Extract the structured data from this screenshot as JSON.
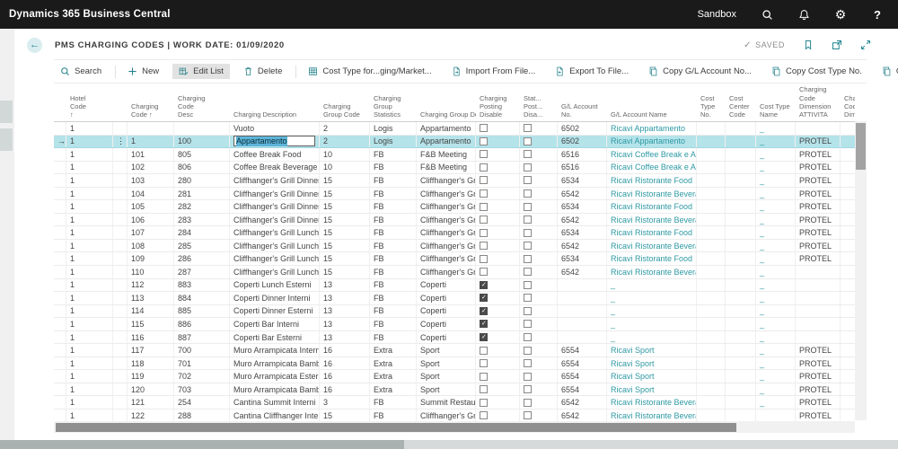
{
  "topbar": {
    "brand": "Dynamics 365 Business Central",
    "environment": "Sandbox",
    "help_label": "?"
  },
  "page": {
    "back_glyph": "←",
    "title": "PMS CHARGING CODES | WORK DATE: 01/09/2020",
    "saved_check": "✓",
    "saved_label": "SAVED"
  },
  "toolbar": {
    "items": [
      {
        "id": "search",
        "label": "Search",
        "icon": "magnifier-icon"
      },
      {
        "id": "new",
        "label": "New",
        "icon": "plus-icon"
      },
      {
        "id": "edit-list",
        "label": "Edit List",
        "icon": "edit-list-icon",
        "active": true
      },
      {
        "id": "delete",
        "label": "Delete",
        "icon": "trash-icon"
      },
      {
        "id": "cost-type-marketing",
        "label": "Cost Type for...ging/Market...",
        "icon": "table-icon"
      },
      {
        "id": "import-from-file",
        "label": "Import From File...",
        "icon": "import-file-icon"
      },
      {
        "id": "export-to-file",
        "label": "Export To File...",
        "icon": "export-file-icon"
      },
      {
        "id": "copy-gl-account",
        "label": "Copy G/L Account No...",
        "icon": "copy-icon"
      },
      {
        "id": "copy-cost-type",
        "label": "Copy Cost Type No.",
        "icon": "copy-icon"
      },
      {
        "id": "copy-cost-center",
        "label": "Copy Cost Center Code",
        "icon": "copy-icon"
      }
    ],
    "overflow_label": "⋯"
  },
  "table": {
    "headers": [
      "",
      "Hotel\nCode\n↑",
      "",
      "Charging\nCode ↑",
      "Charging\nCode\nDesc",
      "Charging Description",
      "Charging\nGroup Code",
      "Charging\nGroup\nStatistics",
      "Charging Group Desc",
      "Charging\nPosting\nDisable",
      "Stat...\nPost...\nDisa...",
      "G/L Account\nNo.",
      "G/L Account Name",
      "Cost\nType\nNo.",
      "Cost\nCenter\nCode",
      "Cost Type\nName",
      "Charging\nCode\nDimension\nATTIVITA",
      "Cha\nCod\nDim"
    ],
    "selected_row_glyph": "→",
    "row_menu_glyph": "⋮",
    "rows": [
      [
        "1",
        "",
        "",
        "Vuoto",
        "2",
        "Logis",
        "Appartamento",
        0,
        0,
        "6502",
        "Ricavi Appartamento",
        "_",
        "",
        ""
      ],
      [
        "1",
        "1",
        "100",
        "Appartamento",
        "2",
        "Logis",
        "Appartamento",
        0,
        0,
        "6502",
        "Ricavi Appartamento",
        "_",
        "PROTEL",
        "sel"
      ],
      [
        "1",
        "101",
        "805",
        "Coffee Break Food",
        "10",
        "FB",
        "F&B Meeting",
        0,
        0,
        "6516",
        "Ricavi Coffee Break e Aperitivi",
        "_",
        "PROTEL",
        ""
      ],
      [
        "1",
        "102",
        "806",
        "Coffee Break Beverage",
        "10",
        "FB",
        "F&B Meeting",
        0,
        0,
        "6516",
        "Ricavi Coffee Break e Aperitivi",
        "_",
        "PROTEL",
        ""
      ],
      [
        "1",
        "103",
        "280",
        "Cliffhanger's Grill Dinner F...",
        "15",
        "FB",
        "Cliffhanger's Grill",
        0,
        0,
        "6534",
        "Ricavi Ristorante Food",
        "_",
        "PROTEL",
        ""
      ],
      [
        "1",
        "104",
        "281",
        "Cliffhanger's Grill Dinner B...",
        "15",
        "FB",
        "Cliffhanger's Grill",
        0,
        0,
        "6542",
        "Ricavi Ristorante Beverage",
        "_",
        "PROTEL",
        ""
      ],
      [
        "1",
        "105",
        "282",
        "Cliffhanger's Grill Dinner F...",
        "15",
        "FB",
        "Cliffhanger's Grill",
        0,
        0,
        "6534",
        "Ricavi Ristorante Food",
        "_",
        "PROTEL",
        ""
      ],
      [
        "1",
        "106",
        "283",
        "Cliffhanger's Grill Dinner B...",
        "15",
        "FB",
        "Cliffhanger's Grill",
        0,
        0,
        "6542",
        "Ricavi Ristorante Beverage",
        "_",
        "PROTEL",
        ""
      ],
      [
        "1",
        "107",
        "284",
        "Cliffhanger's Grill Lunch F...",
        "15",
        "FB",
        "Cliffhanger's Grill",
        0,
        0,
        "6534",
        "Ricavi Ristorante Food",
        "_",
        "PROTEL",
        ""
      ],
      [
        "1",
        "108",
        "285",
        "Cliffhanger's Grill Lunch B...",
        "15",
        "FB",
        "Cliffhanger's Grill",
        0,
        0,
        "6542",
        "Ricavi Ristorante Beverage",
        "_",
        "PROTEL",
        ""
      ],
      [
        "1",
        "109",
        "286",
        "Cliffhanger's Grill Lunch F...",
        "15",
        "FB",
        "Cliffhanger's Grill",
        0,
        0,
        "6534",
        "Ricavi Ristorante Food",
        "_",
        "PROTEL",
        ""
      ],
      [
        "1",
        "110",
        "287",
        "Cliffhanger's Grill Lunch B...",
        "15",
        "FB",
        "Cliffhanger's Grill",
        0,
        0,
        "6542",
        "Ricavi Ristorante Beverage",
        "_",
        "",
        ""
      ],
      [
        "1",
        "112",
        "883",
        "Coperti Lunch Esterni",
        "13",
        "FB",
        "Coperti",
        1,
        0,
        "",
        "_",
        "_",
        "",
        ""
      ],
      [
        "1",
        "113",
        "884",
        "Coperti Dinner Interni",
        "13",
        "FB",
        "Coperti",
        1,
        0,
        "",
        "_",
        "_",
        "",
        ""
      ],
      [
        "1",
        "114",
        "885",
        "Coperti Dinner Esterni",
        "13",
        "FB",
        "Coperti",
        1,
        0,
        "",
        "_",
        "_",
        "",
        ""
      ],
      [
        "1",
        "115",
        "886",
        "Coperti Bar Interni",
        "13",
        "FB",
        "Coperti",
        1,
        0,
        "",
        "_",
        "_",
        "",
        ""
      ],
      [
        "1",
        "116",
        "887",
        "Coperti Bar Esterni",
        "13",
        "FB",
        "Coperti",
        1,
        0,
        "",
        "_",
        "_",
        "",
        ""
      ],
      [
        "1",
        "117",
        "700",
        "Muro Arrampicata Interni",
        "16",
        "Extra",
        "Sport",
        0,
        0,
        "6554",
        "Ricavi Sport",
        "_",
        "PROTEL",
        ""
      ],
      [
        "1",
        "118",
        "701",
        "Muro Arrampicata Bambin...",
        "16",
        "Extra",
        "Sport",
        0,
        0,
        "6554",
        "Ricavi Sport",
        "_",
        "PROTEL",
        ""
      ],
      [
        "1",
        "119",
        "702",
        "Muro Arrampicata Esterni",
        "16",
        "Extra",
        "Sport",
        0,
        0,
        "6554",
        "Ricavi Sport",
        "_",
        "PROTEL",
        ""
      ],
      [
        "1",
        "120",
        "703",
        "Muro Arrampicata Bambin...",
        "16",
        "Extra",
        "Sport",
        0,
        0,
        "6554",
        "Ricavi Sport",
        "_",
        "PROTEL",
        ""
      ],
      [
        "1",
        "121",
        "254",
        "Cantina Summit Interni",
        "3",
        "FB",
        "Summit Restaurant",
        0,
        0,
        "6542",
        "Ricavi Ristorante Beverage",
        "_",
        "PROTEL",
        ""
      ],
      [
        "1",
        "122",
        "288",
        "Cantina Cliffhanger Interni",
        "15",
        "FB",
        "Cliffhanger's Grill",
        0,
        0,
        "6542",
        "Ricavi Ristorante Beverage",
        "",
        "PROTEL",
        ""
      ]
    ]
  },
  "colors": {
    "topbar_bg": "#1a1a1a",
    "accent_teal": "#27828c",
    "link_teal": "#2e99a3",
    "selected_row_bg": "#b5e3ea",
    "edit_selection_bg": "#5db4d8"
  }
}
